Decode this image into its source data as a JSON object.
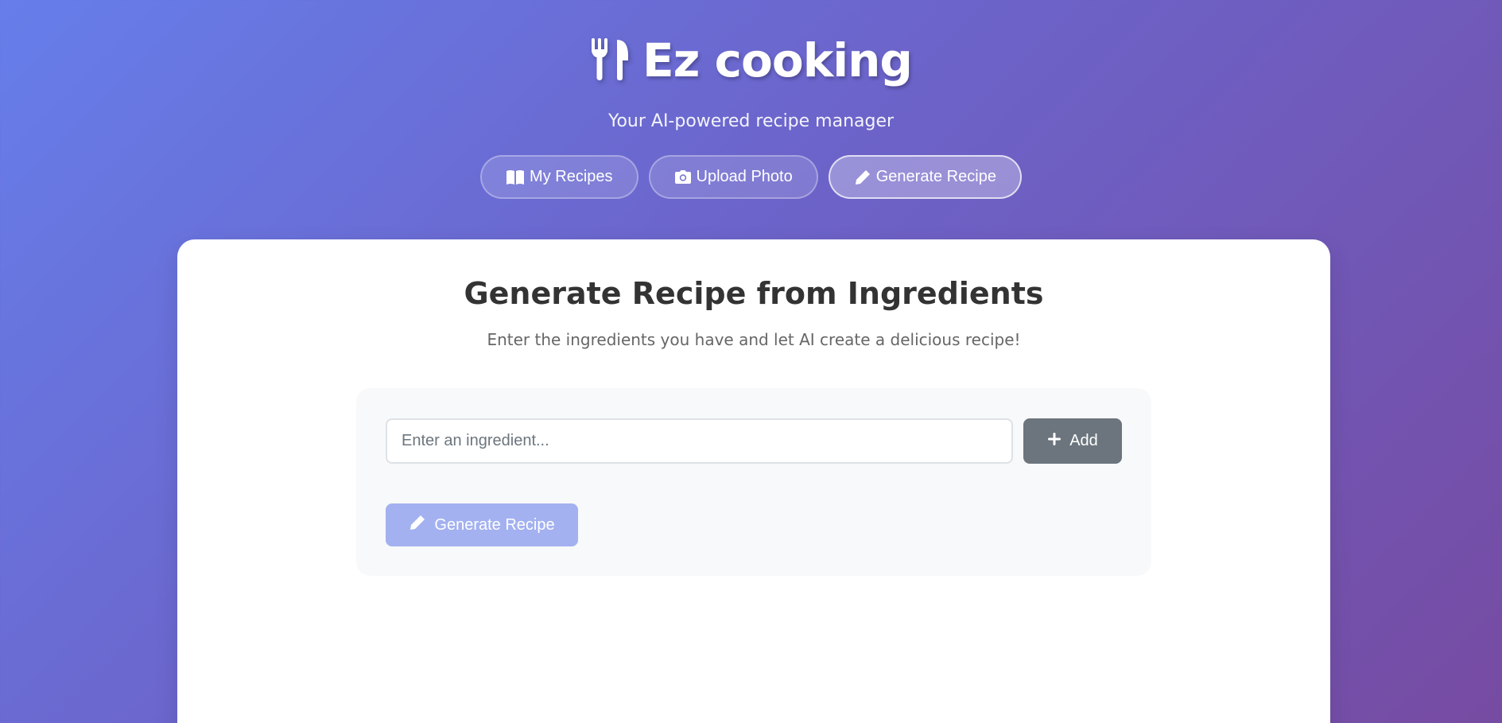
{
  "app": {
    "title": "Ez cooking",
    "subtitle": "Your AI-powered recipe manager",
    "logo_icon": "utensils-icon"
  },
  "nav": {
    "items": [
      {
        "label": "My Recipes",
        "icon": "book-open-icon",
        "active": false
      },
      {
        "label": "Upload Photo",
        "icon": "camera-icon",
        "active": false
      },
      {
        "label": "Generate Recipe",
        "icon": "pencil-icon",
        "active": true
      }
    ]
  },
  "generator": {
    "title": "Generate Recipe from Ingredients",
    "description": "Enter the ingredients you have and let AI create a delicious recipe!",
    "ingredient_input": {
      "value": "",
      "placeholder": "Enter an ingredient..."
    },
    "add_button": {
      "label": "Add",
      "icon": "plus-icon"
    },
    "generate_button": {
      "label": "Generate Recipe",
      "icon": "pencil-icon",
      "enabled": false
    }
  },
  "colors": {
    "gradient_start": "#667eea",
    "gradient_end": "#764ba2",
    "add_button_bg": "#6c757d",
    "generate_button_bg": "#a3b1f0",
    "heading_text": "#333333",
    "panel_bg": "#f8f9fa"
  }
}
